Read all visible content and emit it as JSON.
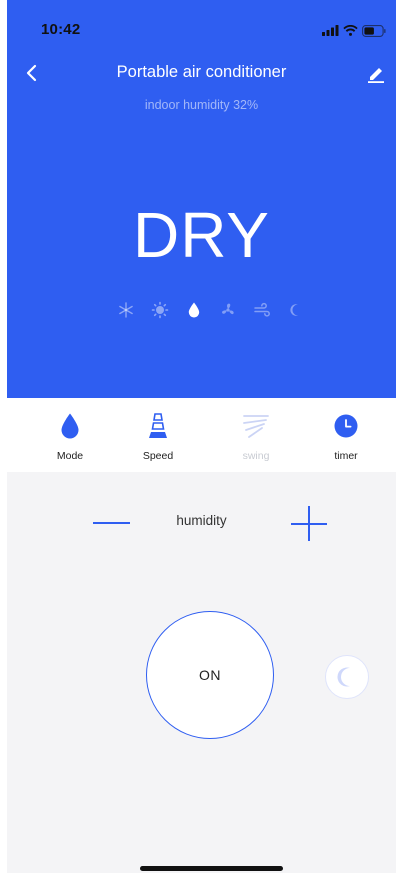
{
  "status_bar": {
    "time": "10:42"
  },
  "header": {
    "title": "Portable air conditioner",
    "subtitle": "indoor humidity 32%"
  },
  "mode": {
    "current": "DRY",
    "icons": [
      "snowflake-icon",
      "sun-icon",
      "water-drop-icon",
      "fan-icon",
      "windy-icon",
      "moon-icon"
    ],
    "active_index": 2
  },
  "toolbar": {
    "mode_label": "Mode",
    "speed_label": "Speed",
    "swing_label": "swing",
    "timer_label": "timer"
  },
  "control": {
    "target_label": "humidity",
    "power_label": "ON"
  },
  "colors": {
    "accent": "#2f5ef1",
    "panel_bg": "#f4f4f6",
    "disabled": "#c8cbd2"
  }
}
